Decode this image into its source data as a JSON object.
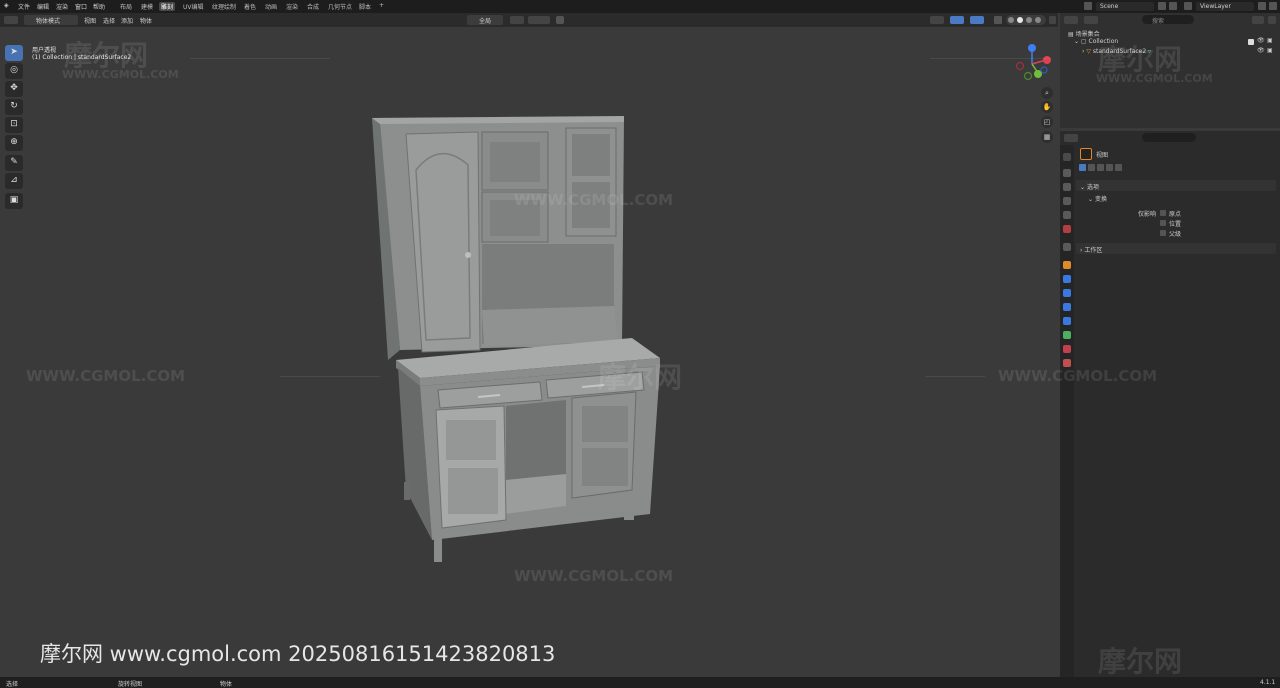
{
  "menu": {
    "logo": "◈",
    "items": [
      "文件",
      "编辑",
      "渲染",
      "窗口",
      "帮助"
    ]
  },
  "workspace_tabs": [
    "布局",
    "建模",
    "雕刻",
    "UV编辑",
    "纹理绘制",
    "着色",
    "动画",
    "渲染",
    "合成",
    "几何节点",
    "脚本",
    "+"
  ],
  "active_workspace": "雕刻",
  "scene": {
    "name": "Scene",
    "view_layer": "ViewLayer",
    "search_placeholder": "搜索"
  },
  "viewport_header": {
    "mode": "物体模式",
    "menus": [
      "视图",
      "选择",
      "添加",
      "物体"
    ],
    "transform_orientation": "全局",
    "options_label": "选项"
  },
  "viewport_info": {
    "view_name": "用户透视",
    "object_info": "(1) Collection | standardSurface2"
  },
  "outliner": {
    "root": "场景集合",
    "collection": "Collection",
    "object": "standardSurface2"
  },
  "properties": {
    "search_placeholder": "",
    "object_name": "视图",
    "panel_options": "选项",
    "panel_transform": "变换",
    "affect_only_label": "仅影响",
    "affect_only_items": [
      "原点",
      "位置",
      "父级"
    ],
    "panel_workspace": "工作区"
  },
  "statusbar": {
    "left": "选择",
    "middle": "旋转视图",
    "right_obj": "物体",
    "version": "4.1.1"
  },
  "watermark": {
    "brand_cn": "摩尔网",
    "brand_url": "WWW.CGMOL.COM",
    "overlay": "摩尔网 www.cgmol.com 20250816151423820813"
  },
  "colors": {
    "accent": "#4772b3",
    "bg_viewport": "#3a3a3a",
    "bg_header": "#2b2b2b",
    "model_gray": "#8c8c8c"
  }
}
